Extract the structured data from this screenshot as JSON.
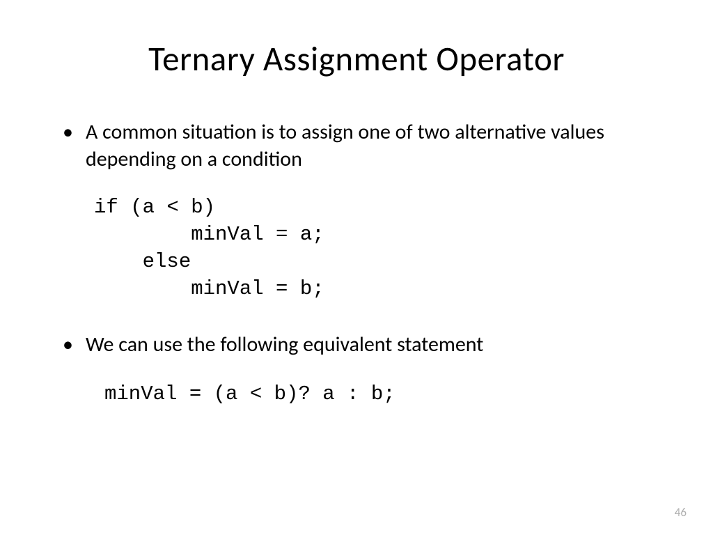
{
  "title": "Ternary Assignment Operator",
  "bullets": [
    "A common situation is to assign one of two alternative values depending on a condition",
    "We can use the following equivalent statement"
  ],
  "code_blocks": [
    "if (a < b)\n        minVal = a;\n    else\n        minVal = b;",
    "minVal = (a < b)? a : b;"
  ],
  "page_number": "46"
}
